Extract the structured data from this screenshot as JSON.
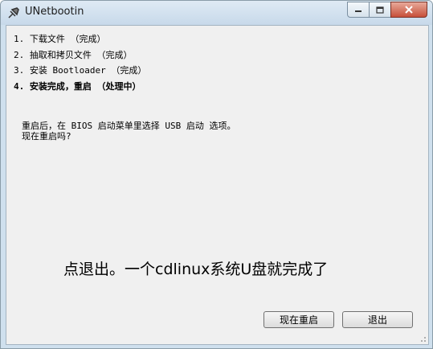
{
  "window": {
    "title": "UNetbootin"
  },
  "steps": [
    "1. 下载文件 （完成）",
    "2. 抽取和拷贝文件 （完成）",
    "3. 安装 Bootloader （完成）",
    "4. 安装完成，重启 （处理中）"
  ],
  "message": {
    "line1": "重启后，在 BIOS 启动菜单里选择 USB 启动 选项。",
    "line2": "现在重启吗?"
  },
  "overlay_text": "点退出。一个cdlinux系统U盘就完成了",
  "buttons": {
    "reboot": "现在重启",
    "exit": "退出"
  }
}
